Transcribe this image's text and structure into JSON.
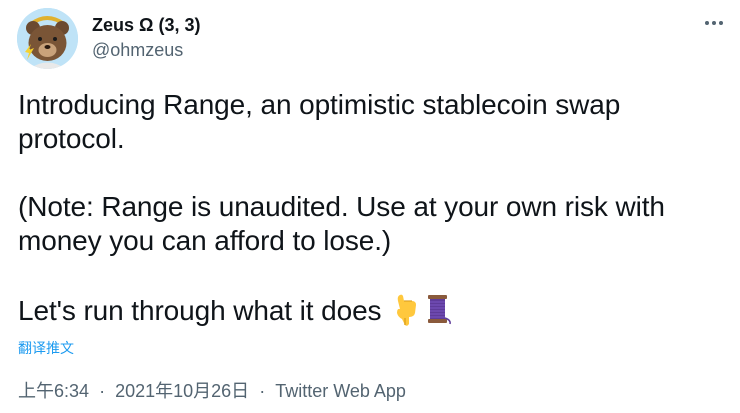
{
  "author": {
    "display_name": "Zeus Ω (3, 3)",
    "handle": "@ohmzeus",
    "avatar_icon": "bear-avatar-icon"
  },
  "menu": {
    "icon": "more-options-icon"
  },
  "tweet": {
    "line1": "Introducing Range, an optimistic stablecoin swap",
    "line2": "protocol.",
    "line3": "(Note: Range is unaudited. Use at your own risk with",
    "line4": "money you can afford to lose.)",
    "line5": "Let's run through what it does",
    "emojis": [
      "backhand-index-pointing-down",
      "thread-spool"
    ]
  },
  "translate_label": "翻译推文",
  "meta": {
    "time": "上午6:34",
    "separator": "·",
    "date": "2021年10月26日",
    "app": "Twitter Web App"
  },
  "colors": {
    "text": "#0f1419",
    "secondary": "#536471",
    "link": "#1d9bf0"
  }
}
